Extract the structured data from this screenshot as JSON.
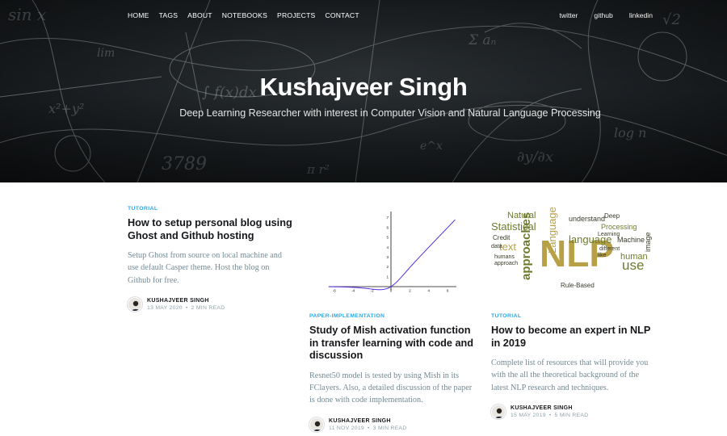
{
  "nav": {
    "left": [
      "HOME",
      "TAGS",
      "ABOUT",
      "NOTEBOOKS",
      "PROJECTS",
      "CONTACT"
    ],
    "right": [
      "twitter",
      "github",
      "linkedin"
    ]
  },
  "site": {
    "title": "Kushajveer Singh",
    "description": "Deep Learning Researcher with interest in Computer Vision and Natural Language Processing"
  },
  "posts": [
    {
      "tag": "TUTORIAL",
      "title": "How to setup personal blog using Ghost and Github hosting",
      "excerpt": "Setup Ghost from source on local machine and use default Casper theme. Host the blog on Github for free.",
      "author": "KUSHAJVEER SINGH",
      "date": "13 MAY 2020",
      "read_time": "2 MIN READ",
      "image": null
    },
    {
      "tag": "PAPER-IMPLEMENTATION",
      "title": "Study of Mish activation function in transfer learning with code and discussion",
      "excerpt": "Resnet50 model is tested by using Mish in its FClayers. Also, a detailed discussion of the paper is done with code implementation.",
      "author": "KUSHAJVEER SINGH",
      "date": "11 NOV 2019",
      "read_time": "3 MIN READ",
      "image": "mish-activation-plot",
      "plot": {
        "x_ticks": [
          "-6",
          "-4",
          "-2",
          "0",
          "2",
          "4",
          "6"
        ],
        "y_ticks": [
          "1",
          "2",
          "3",
          "4",
          "5",
          "6",
          "7"
        ]
      }
    },
    {
      "tag": "TUTORIAL",
      "title": "How to become an expert in NLP in 2019",
      "excerpt": "Complete list of resources that will provide you with the all the theoretical background of the latest NLP research and techniques.",
      "author": "KUSHAJVEER SINGH",
      "date": "15 MAY 2019",
      "read_time": "5 MIN READ",
      "image": "nlp-word-cloud",
      "wordcloud": [
        "NLP",
        "Language",
        "Statistical",
        "approaches",
        "Natural",
        "language",
        "Processing",
        "text",
        "use",
        "Machine",
        "human",
        "Credit",
        "understand",
        "Rule-Based",
        "Learning",
        "different",
        "image",
        "data",
        "humans",
        "like",
        "approach",
        "Deep"
      ]
    }
  ],
  "colors": {
    "accent": "#26a8ed",
    "plot_line": "#5a2ee0",
    "wordcloud_gold": "#b8a046",
    "wordcloud_olive": "#6e7b2e",
    "wordcloud_dark": "#3a3b2c"
  }
}
